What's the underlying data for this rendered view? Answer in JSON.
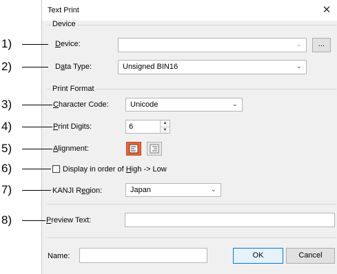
{
  "dialog": {
    "title": "Text Print",
    "close_glyph": "✕"
  },
  "callouts": [
    "1)",
    "2)",
    "3)",
    "4)",
    "5)",
    "6)",
    "7)",
    "8)"
  ],
  "device_group": {
    "title": "Device",
    "device_label": "Device:",
    "device_value": "",
    "browse_label": "...",
    "data_type_label": "Data Type:",
    "data_type_value": "Unsigned BIN16"
  },
  "print_format_group": {
    "title": "Print Format",
    "char_code_label": "Character Code:",
    "char_code_value": "Unicode",
    "print_digits_label": "Print Digits:",
    "print_digits_value": "6",
    "alignment_label": "Alignment:",
    "alignment_left_icon": "align-left-icon",
    "alignment_right_icon": "align-right-icon",
    "display_order_label": "Display in order of High -> Low",
    "display_order_checked": false,
    "kanji_region_label": "KANJI Region:",
    "kanji_region_value": "Japan"
  },
  "preview": {
    "label": "Preview Text:",
    "value": ""
  },
  "footer": {
    "name_label": "Name:",
    "name_value": "",
    "ok_label": "OK",
    "cancel_label": "Cancel"
  },
  "colors": {
    "accent": "#e8663c",
    "dialog_bg": "#f0f0f0",
    "ok_border": "#0078d7"
  }
}
